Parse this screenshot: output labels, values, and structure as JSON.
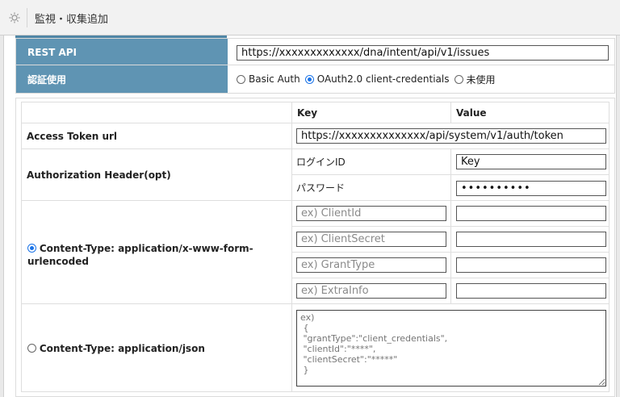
{
  "window": {
    "title": "監視・収集追加",
    "icon": "gear-icon"
  },
  "rest_api": {
    "label": "REST API",
    "value": "https://xxxxxxxxxxxxx/dna/intent/api/v1/issues"
  },
  "auth": {
    "label": "認証使用",
    "options": [
      {
        "label": "Basic Auth",
        "selected": false
      },
      {
        "label": "OAuth2.0 client-credentials",
        "selected": true
      },
      {
        "label": "未使用",
        "selected": false
      }
    ]
  },
  "table": {
    "headers": {
      "key": "Key",
      "value": "Value"
    },
    "access_token": {
      "label": "Access Token url",
      "value": "https://xxxxxxxxxxxxxx/api/system/v1/auth/token"
    },
    "authorization": {
      "label": "Authorization Header(opt)",
      "rows": [
        {
          "key": "ログインID",
          "value": "Key"
        },
        {
          "key": "パスワード",
          "value": "••••••••••"
        }
      ]
    },
    "form": {
      "label": "Content-Type: application/x-www-form-urlencoded",
      "selected": true,
      "rows": [
        {
          "key_placeholder": "ex) ClientId",
          "value": ""
        },
        {
          "key_placeholder": "ex) ClientSecret",
          "value": ""
        },
        {
          "key_placeholder": "ex) GrantType",
          "value": ""
        },
        {
          "key_placeholder": "ex) ExtraInfo",
          "value": ""
        }
      ]
    },
    "json": {
      "label": "Content-Type: application/json",
      "selected": false,
      "placeholder": "ex)\n {\n \"grantType\":\"client_credentials\",\n \"clientId\":\"****\",\n \"clientSecret\":\"*****\"\n }"
    }
  },
  "colors": {
    "label_bg": "#5f94b3",
    "accent": "#1a73e8"
  }
}
